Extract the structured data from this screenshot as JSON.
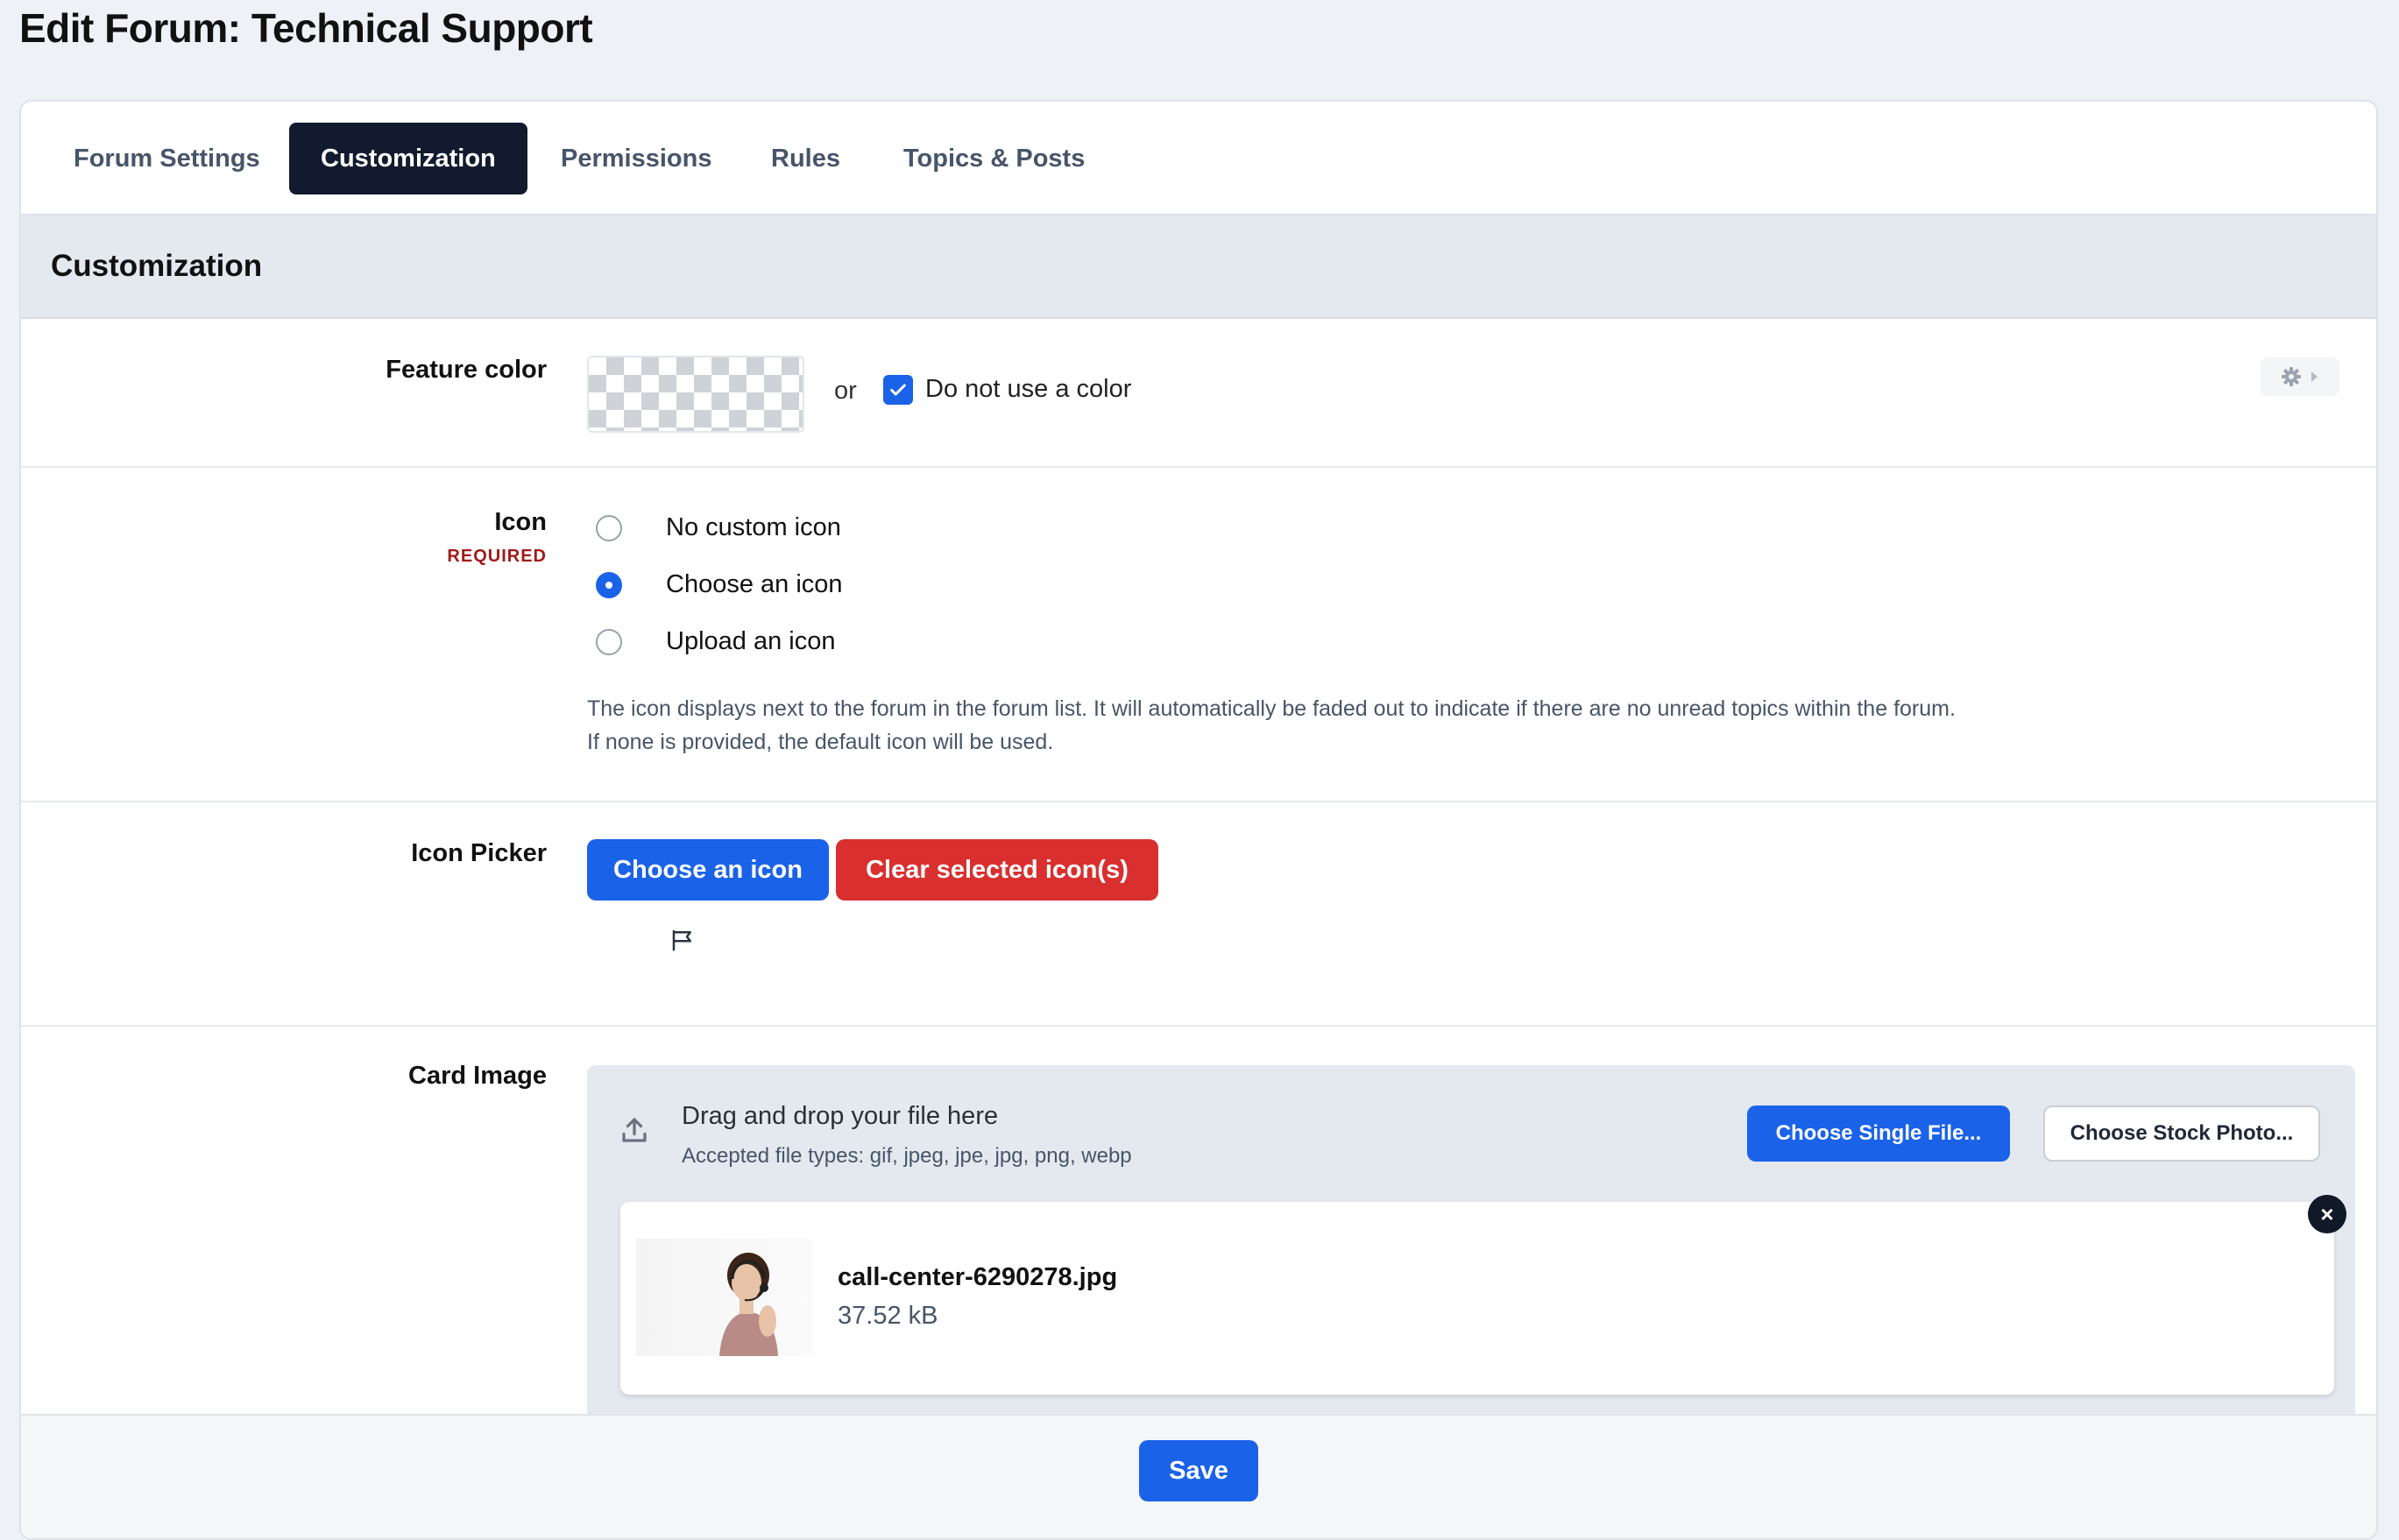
{
  "page": {
    "title": "Edit Forum: Technical Support"
  },
  "tabs": [
    {
      "label": "Forum Settings",
      "active": false
    },
    {
      "label": "Customization",
      "active": true
    },
    {
      "label": "Permissions",
      "active": false
    },
    {
      "label": "Rules",
      "active": false
    },
    {
      "label": "Topics & Posts",
      "active": false
    }
  ],
  "section": {
    "title": "Customization"
  },
  "feature_color": {
    "label": "Feature color",
    "or_text": "or",
    "no_color_label": "Do not use a color",
    "no_color_checked": true
  },
  "icon": {
    "label": "Icon",
    "required_text": "REQUIRED",
    "options": [
      {
        "label": "No custom icon",
        "checked": false
      },
      {
        "label": "Choose an icon",
        "checked": true
      },
      {
        "label": "Upload an icon",
        "checked": false
      }
    ],
    "help_line1": "The icon displays next to the forum in the forum list. It will automatically be faded out to indicate if there are no unread topics within the forum.",
    "help_line2": "If none is provided, the default icon will be used."
  },
  "icon_picker": {
    "label": "Icon Picker",
    "choose_label": "Choose an icon",
    "clear_label": "Clear selected icon(s)",
    "selected_icon": "flag-icon"
  },
  "card_image": {
    "label": "Card Image",
    "drop_title": "Drag and drop your file here",
    "accepted_text": "Accepted file types: gif, jpeg, jpe, jpg, png, webp",
    "choose_file_label": "Choose Single File...",
    "stock_photo_label": "Choose Stock Photo...",
    "file": {
      "name": "call-center-6290278.jpg",
      "size": "37.52 kB"
    }
  },
  "footer": {
    "save_label": "Save"
  },
  "colors": {
    "primary": "#1a63e8",
    "danger": "#d92f2f",
    "dark": "#111a2e",
    "required": "#a11a1a"
  }
}
